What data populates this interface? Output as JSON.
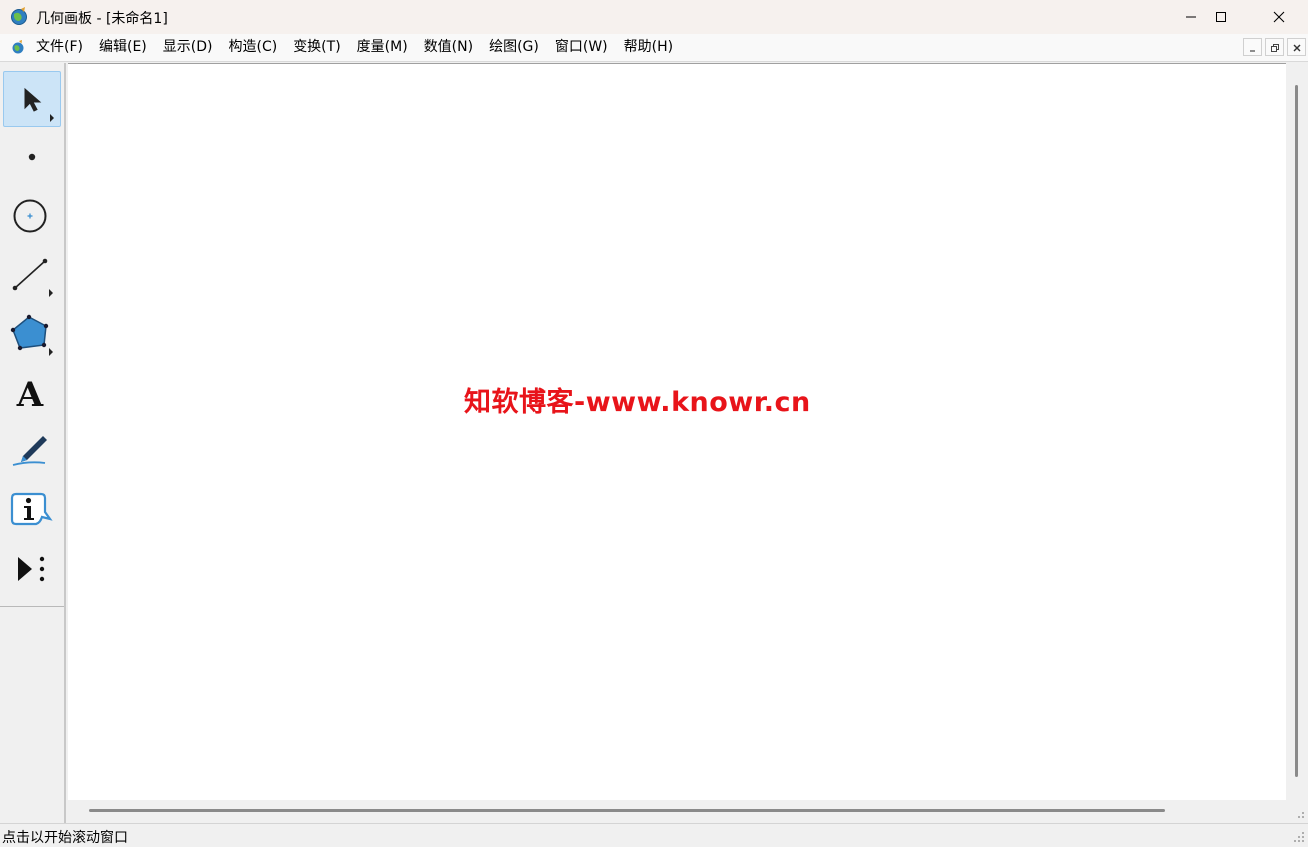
{
  "window": {
    "title": "几何画板 - [未命名1]",
    "controls": [
      "minimize-icon",
      "maximize-icon",
      "close-icon"
    ]
  },
  "menu": {
    "items": [
      {
        "label": "文件(F)"
      },
      {
        "label": "编辑(E)"
      },
      {
        "label": "显示(D)"
      },
      {
        "label": "构造(C)"
      },
      {
        "label": "变换(T)"
      },
      {
        "label": "度量(M)"
      },
      {
        "label": "数值(N)"
      },
      {
        "label": "绘图(G)"
      },
      {
        "label": "窗口(W)"
      },
      {
        "label": "帮助(H)"
      }
    ],
    "mdi_controls": [
      "minimize-icon",
      "restore-icon",
      "close-icon"
    ]
  },
  "toolbox": {
    "tools": [
      {
        "name": "arrow-select-tool",
        "icon": "arrow-cursor-icon",
        "selected": true
      },
      {
        "name": "point-tool",
        "icon": "point-icon",
        "selected": false
      },
      {
        "name": "compass-tool",
        "icon": "circle-icon",
        "selected": false
      },
      {
        "name": "straightedge-tool",
        "icon": "segment-icon",
        "selected": false
      },
      {
        "name": "polygon-tool",
        "icon": "pentagon-icon",
        "selected": false
      },
      {
        "name": "text-tool",
        "icon": "letter-a-icon",
        "selected": false
      },
      {
        "name": "marker-tool",
        "icon": "marker-pen-icon",
        "selected": false
      },
      {
        "name": "information-tool",
        "icon": "info-bubble-icon",
        "selected": false
      },
      {
        "name": "custom-tool",
        "icon": "play-more-icon",
        "selected": false
      }
    ]
  },
  "canvas": {
    "watermark": "知软博客-www.knowr.cn"
  },
  "status": {
    "text": "点击以开始滚动窗口"
  },
  "colors": {
    "watermark": "#e8141a",
    "selected_tool_bg": "#cce4f7",
    "polygon_fill": "#3b8fd1"
  }
}
